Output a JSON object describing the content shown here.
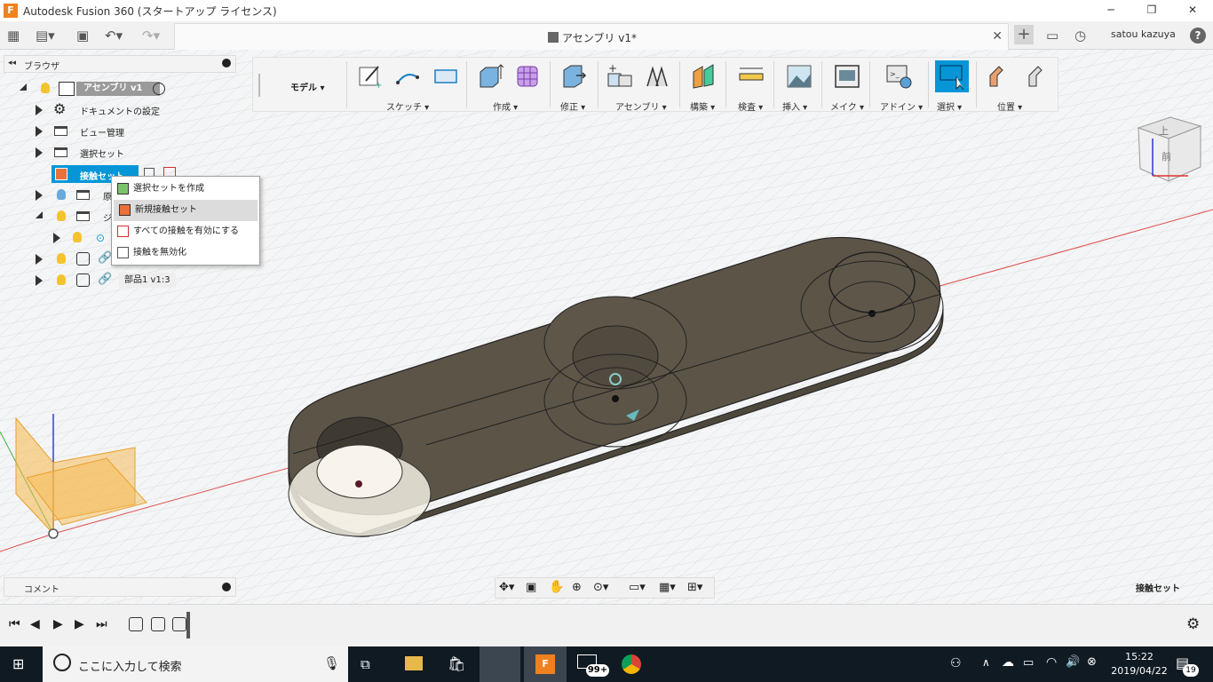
{
  "window": {
    "title": "Autodesk Fusion 360 (スタートアップ ライセンス)",
    "minimize": "─",
    "maximize": "❐",
    "close": "✕"
  },
  "appbar": {
    "document_tab": "アセンブリ v1*",
    "close_tab": "✕",
    "new_tab": "+",
    "user": "satou kazuya",
    "help": "?"
  },
  "toolbar": {
    "workspace": "モデル ▾",
    "groups": [
      "スケッチ ▾",
      "作成 ▾",
      "修正 ▾",
      "アセンブリ ▾",
      "構築 ▾",
      "検査 ▾",
      "挿入 ▾",
      "メイク ▾",
      "アドイン ▾",
      "選択 ▾",
      "位置 ▾"
    ]
  },
  "viewcube": {
    "top": "上",
    "front": "前"
  },
  "browser": {
    "title": "ブラウザ",
    "root": "アセンブリ v1",
    "items": [
      "ドキュメントの設定",
      "ビュー管理",
      "選択セット",
      "接触セット",
      "原",
      "ジ",
      "部品1 v1:3"
    ]
  },
  "context_menu": {
    "items": [
      "選択セットを作成",
      "新規接触セット",
      "すべての接触を有効にする",
      "接触を無効化"
    ]
  },
  "comments": {
    "label": "コメント"
  },
  "status": {
    "label": "接触セット"
  },
  "taskbar": {
    "search_placeholder": "ここに入力して検索",
    "badge": "99+",
    "time": "15:22",
    "date": "2019/04/22",
    "notifications": "19"
  },
  "colors": {
    "accent": "#0696d7",
    "part": "#5b5447",
    "grid": "#d6d9dc",
    "taskbar": "#101a22"
  }
}
